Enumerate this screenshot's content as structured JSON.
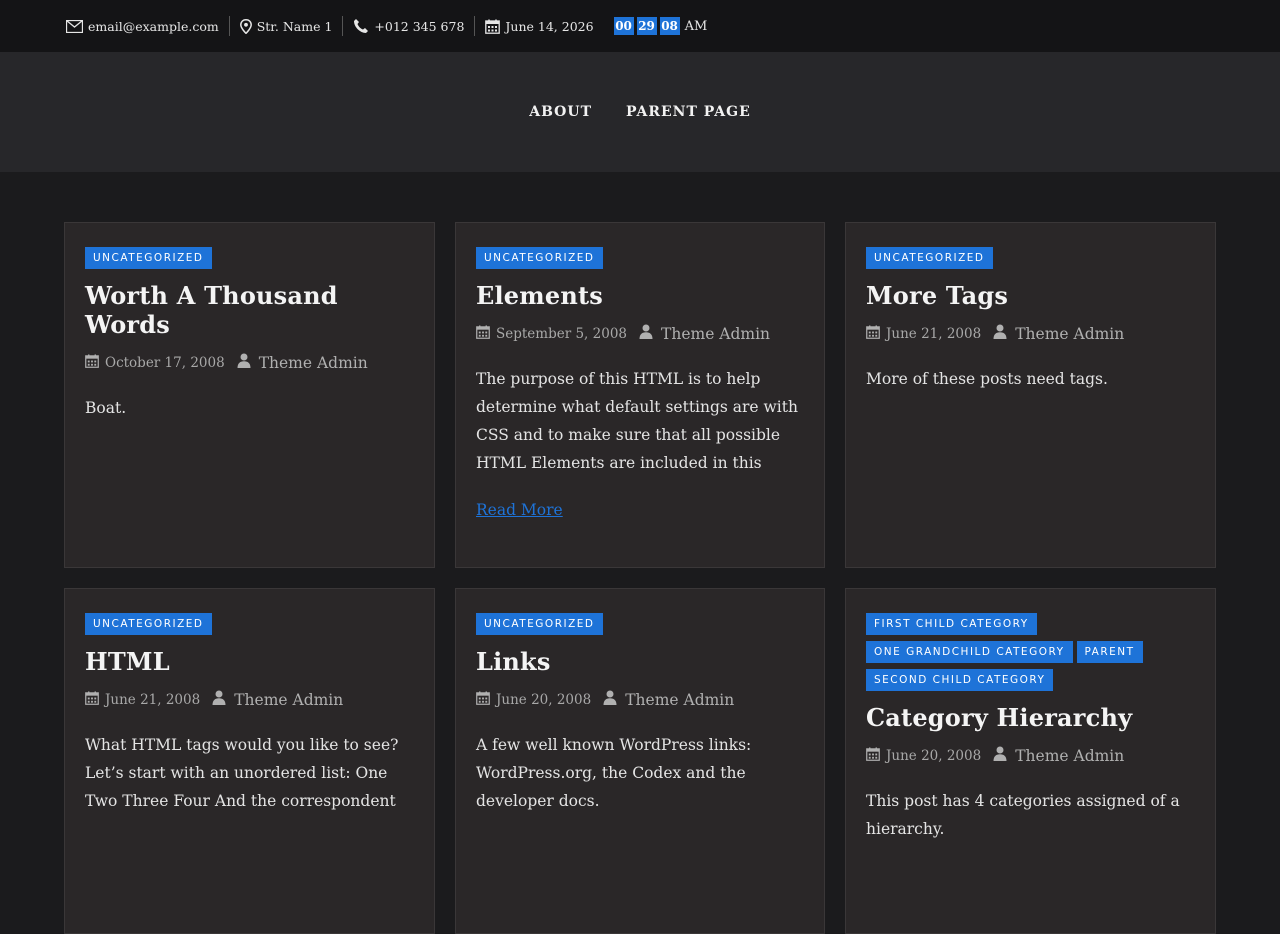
{
  "topbar": {
    "email": "email@example.com",
    "address": "Str. Name 1",
    "phone": "+012 345 678",
    "date": "June 14, 2026",
    "clock": {
      "hours": "00",
      "minutes": "29",
      "seconds": "08",
      "ampm": "AM"
    }
  },
  "nav": {
    "items": [
      "ABOUT",
      "PARENT PAGE"
    ]
  },
  "posts": [
    {
      "categories": [
        "UNCATEGORIZED"
      ],
      "title": "Worth A Thousand Words",
      "date": "October 17, 2008",
      "author": "Theme Admin",
      "excerpt": "Boat.",
      "read_more": ""
    },
    {
      "categories": [
        "UNCATEGORIZED"
      ],
      "title": "Elements",
      "date": "September 5, 2008",
      "author": "Theme Admin",
      "excerpt": "The purpose of this HTML is to help determine what default settings are with CSS and to make sure that all possible HTML Elements are included in this",
      "read_more": "Read More"
    },
    {
      "categories": [
        "UNCATEGORIZED"
      ],
      "title": "More Tags",
      "date": "June 21, 2008",
      "author": "Theme Admin",
      "excerpt": "More of these posts need tags.",
      "read_more": ""
    },
    {
      "categories": [
        "UNCATEGORIZED"
      ],
      "title": "HTML",
      "date": "June 21, 2008",
      "author": "Theme Admin",
      "excerpt": "What HTML tags would you like to see? Let’s start with an unordered list: One Two Three Four And the correspondent",
      "read_more": ""
    },
    {
      "categories": [
        "UNCATEGORIZED"
      ],
      "title": "Links",
      "date": "June 20, 2008",
      "author": "Theme Admin",
      "excerpt": "A few well known WordPress links: WordPress.org, the Codex and the developer docs.",
      "read_more": ""
    },
    {
      "categories": [
        "FIRST CHILD CATEGORY",
        "ONE GRANDCHILD CATEGORY",
        "PARENT",
        "SECOND CHILD CATEGORY"
      ],
      "title": "Category Hierarchy",
      "date": "June 20, 2008",
      "author": "Theme Admin",
      "excerpt": "This post has 4 categories assigned of a hierarchy.",
      "read_more": ""
    }
  ],
  "colors": {
    "accent": "#1e73d8",
    "topbar_bg": "#141416",
    "nav_bg": "#27272a",
    "card_bg": "#2a2728"
  }
}
